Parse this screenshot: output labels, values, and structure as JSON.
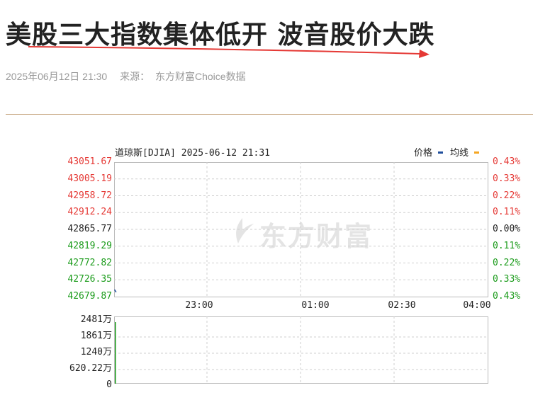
{
  "article": {
    "headline": "美股三大指数集体低开 波音股价大跌",
    "datetime": "2025年06月12日 21:30",
    "source_label": "来源：",
    "source_name": "东方财富Choice数据"
  },
  "chart": {
    "header": "道琼斯[DJIA] 2025-06-12 21:31",
    "legend": [
      {
        "label": "价格",
        "color": "#1f4e9c"
      },
      {
        "label": "均线",
        "color": "#f5a623"
      }
    ],
    "watermark": "东方财富",
    "y_price_labels": [
      "43051.67",
      "43005.19",
      "42958.72",
      "42912.24",
      "42865.77",
      "42819.29",
      "42772.82",
      "42726.35",
      "42679.87"
    ],
    "y_pct_labels": [
      "0.43%",
      "0.33%",
      "0.22%",
      "0.11%",
      "0.00%",
      "0.11%",
      "0.22%",
      "0.33%",
      "0.43%"
    ],
    "label_colors": [
      "#e53935",
      "#e53935",
      "#e53935",
      "#e53935",
      "#222222",
      "#1a9b1a",
      "#1a9b1a",
      "#1a9b1a",
      "#1a9b1a"
    ],
    "x_labels": [
      "23:00",
      "01:00",
      "02:30",
      "04:00"
    ],
    "volume_labels": [
      "2481万",
      "1861万",
      "1240万",
      "620.22万",
      "0"
    ]
  },
  "chart_data": {
    "type": "line",
    "title": "道琼斯[DJIA] 2025-06-12 21:31",
    "x": [
      "21:30",
      "21:31"
    ],
    "series": [
      {
        "name": "价格",
        "values": [
          42700,
          42695
        ]
      }
    ],
    "volume": [
      2481
    ],
    "ylim": [
      42679.87,
      43051.67
    ],
    "prev_close": 42865.77,
    "x_ticks": [
      "23:00",
      "01:00",
      "02:30",
      "04:00"
    ],
    "volume_ticks": [
      "2481万",
      "1861万",
      "1240万",
      "620.22万",
      "0"
    ],
    "volume_ylim": [
      0,
      2481
    ],
    "grid": true,
    "legend_position": "top-right"
  }
}
